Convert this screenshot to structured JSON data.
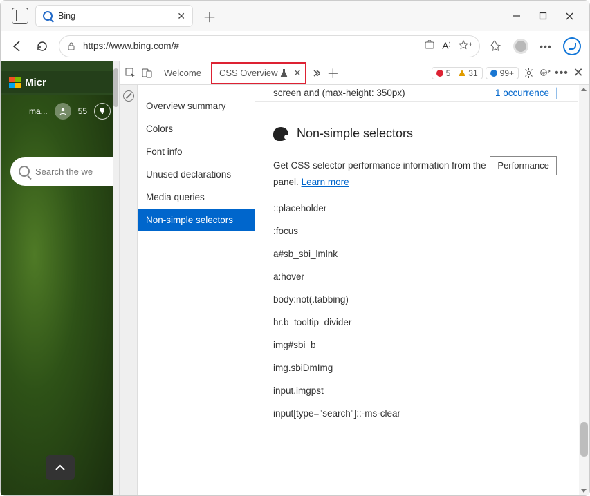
{
  "browser": {
    "tab_title": "Bing",
    "url": "https://www.bing.com/#"
  },
  "page": {
    "brand_text": "Micr",
    "profile_label": "ma...",
    "points": "55",
    "search_placeholder": "Search the we"
  },
  "devtools": {
    "tabs": {
      "welcome": "Welcome",
      "css_overview": "CSS Overview"
    },
    "counters": {
      "errors": "5",
      "warnings": "31",
      "info": "99+"
    },
    "remnant_text": "screen and (max-height: 350px)",
    "remnant_link": "1 occurrence",
    "sidenav": [
      "Overview summary",
      "Colors",
      "Font info",
      "Unused declarations",
      "Media queries",
      "Non-simple selectors"
    ],
    "section_title": "Non-simple selectors",
    "perf_sentence_a": "Get CSS selector performance information from the",
    "perf_button": "Performance",
    "perf_sentence_b": "panel.",
    "learn_more": "Learn more",
    "selectors": [
      "::placeholder",
      ":focus",
      "a#sb_sbi_lmlnk",
      "a:hover",
      "body:not(.tabbing)",
      "hr.b_tooltip_divider",
      "img#sbi_b",
      "img.sbiDmImg",
      "input.imgpst",
      "input[type=\"search\"]::-ms-clear"
    ]
  }
}
